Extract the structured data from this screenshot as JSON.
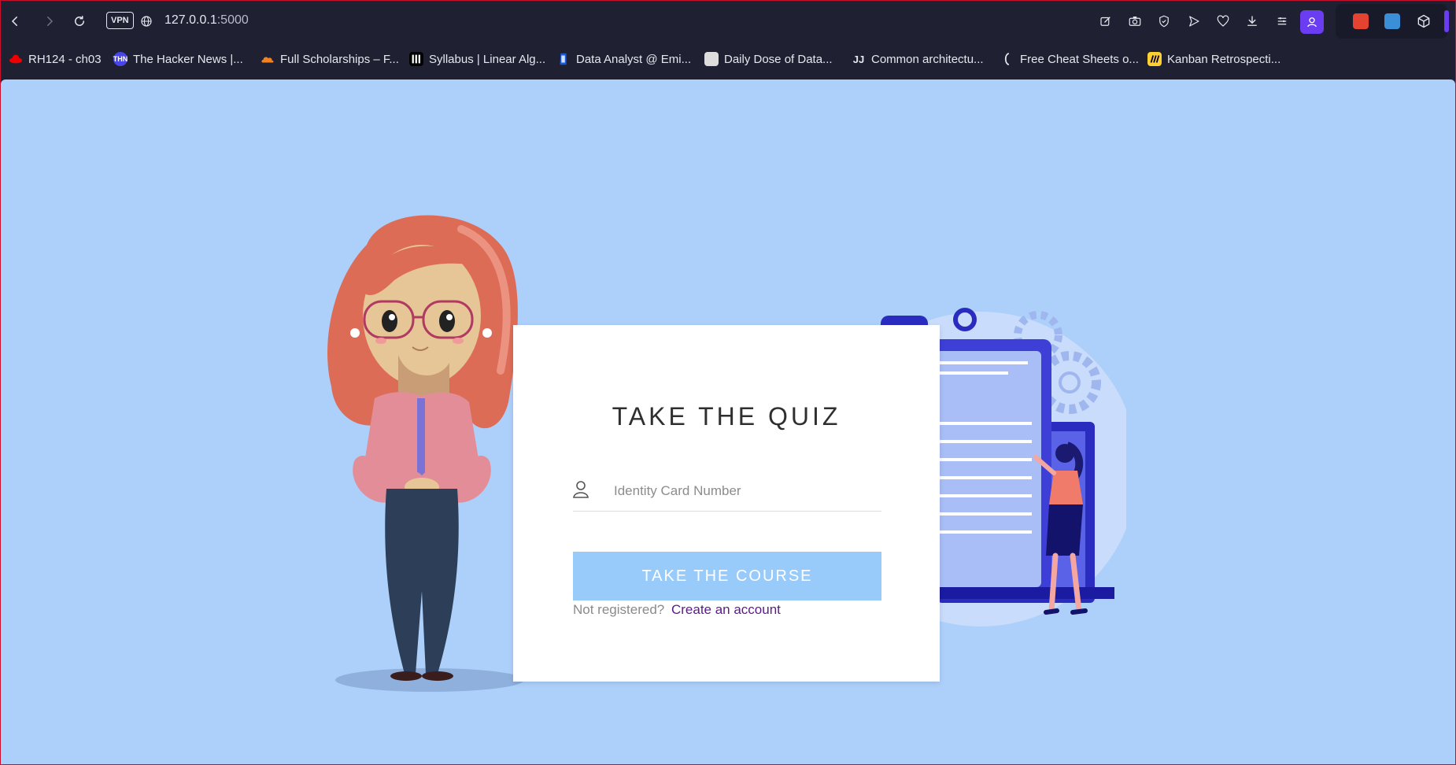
{
  "browser": {
    "vpn_label": "VPN",
    "url_host": "127.0.0.1",
    "url_port": ":5000",
    "accent_color": "#6a3cf2"
  },
  "bookmarks": [
    {
      "label": "RH124 - ch03",
      "icon": "redhat-icon",
      "badge": ""
    },
    {
      "label": "The Hacker News |...",
      "icon": "thn-icon",
      "badge": "THN"
    },
    {
      "label": "Full Scholarships – F...",
      "icon": "cloud-icon",
      "badge": ""
    },
    {
      "label": "Syllabus | Linear Alg...",
      "icon": "mit-icon",
      "badge": ""
    },
    {
      "label": "Data Analyst @ Emi...",
      "icon": "page-icon",
      "badge": ""
    },
    {
      "label": "Daily Dose of Data...",
      "icon": "image-icon",
      "badge": ""
    },
    {
      "label": "Common architectu...",
      "icon": "jj-icon",
      "badge": "JJ"
    },
    {
      "label": "Free Cheat Sheets o...",
      "icon": "bracket-icon",
      "badge": ""
    },
    {
      "label": "Kanban Retrospecti...",
      "icon": "miro-icon",
      "badge": ""
    }
  ],
  "page": {
    "background": "#add0fb",
    "title": "TAKE THE QUIZ",
    "id_placeholder": "Identity Card Number",
    "id_value": "",
    "course_button": "TAKE THE COURSE",
    "button_color": "#99cbfa",
    "not_registered": "Not registered?",
    "create_account": "Create an account"
  }
}
